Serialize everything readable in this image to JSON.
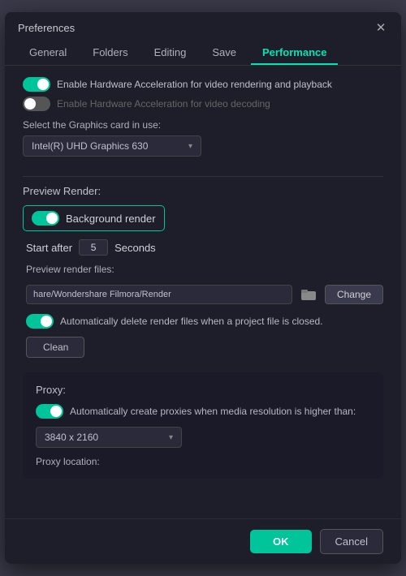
{
  "dialog": {
    "title": "Preferences",
    "close_label": "✕"
  },
  "tabs": [
    {
      "label": "General",
      "active": false
    },
    {
      "label": "Folders",
      "active": false
    },
    {
      "label": "Editing",
      "active": false
    },
    {
      "label": "Save",
      "active": false
    },
    {
      "label": "Performance",
      "active": true
    }
  ],
  "hw_accel": {
    "label1": "Enable Hardware Acceleration for video rendering and playback",
    "label2": "Enable Hardware Acceleration for video decoding"
  },
  "graphics_card": {
    "label": "Select the Graphics card in use:",
    "value": "Intel(R) UHD Graphics 630"
  },
  "preview_render": {
    "section_title": "Preview Render:",
    "bg_render_label": "Background render",
    "start_after_label": "Start after",
    "start_after_value": "5",
    "seconds_label": "Seconds",
    "files_label": "Preview render files:",
    "file_path": "hare/Wondershare Filmora/Render",
    "change_label": "Change",
    "auto_delete_label": "Automatically delete render files when a project file is closed.",
    "clean_label": "Clean"
  },
  "proxy": {
    "section_title": "Proxy:",
    "auto_label": "Automatically create proxies when media resolution is higher than:",
    "dropdown_value": "3840 x 2160",
    "location_label": "Proxy location:"
  },
  "footer": {
    "ok_label": "OK",
    "cancel_label": "Cancel"
  }
}
